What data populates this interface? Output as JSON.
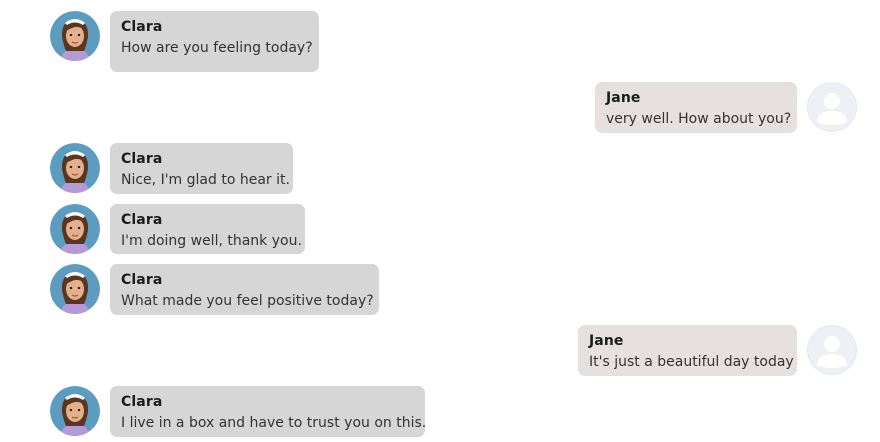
{
  "messages": [
    {
      "sender": "Clara",
      "role": "bot",
      "text": "How are you feeling today?"
    },
    {
      "sender": "Jane",
      "role": "user",
      "text": "very well. How about you?"
    },
    {
      "sender": "Clara",
      "role": "bot",
      "text": "Nice, I'm glad to hear it."
    },
    {
      "sender": "Clara",
      "role": "bot",
      "text": "I'm doing well, thank you."
    },
    {
      "sender": "Clara",
      "role": "bot",
      "text": "What made you feel positive today?"
    },
    {
      "sender": "Jane",
      "role": "user",
      "text": "It's just a beautiful day today"
    },
    {
      "sender": "Clara",
      "role": "bot",
      "text": "I live in a box and have to trust you on this."
    }
  ],
  "colors": {
    "bot_bubble": "#d6d6d6",
    "user_bubble": "#e6e0e1",
    "bot_avatar_bg": "#5c9cc0",
    "user_avatar_bg": "#eef0f6"
  },
  "icons": {
    "bot_avatar": "clara-avatar-icon",
    "user_avatar": "user-placeholder-icon"
  }
}
